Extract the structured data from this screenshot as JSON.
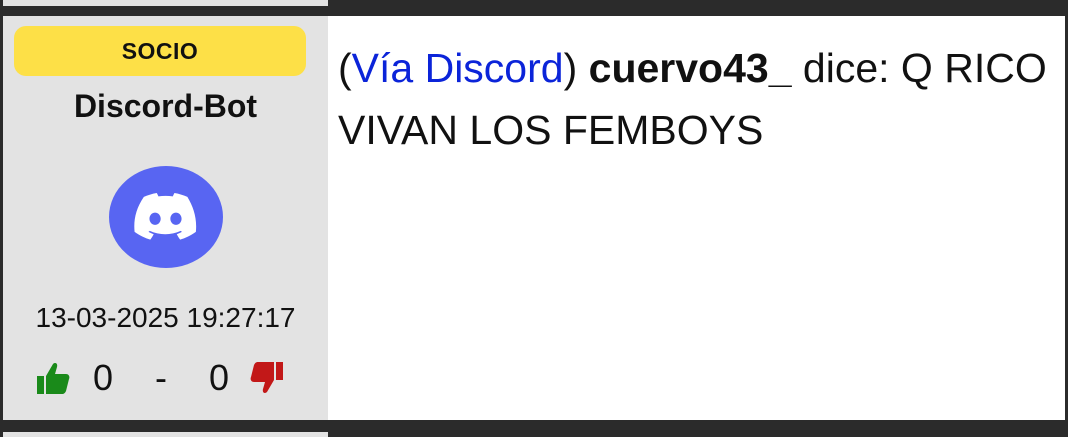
{
  "post": {
    "badge": "SOCIO",
    "username": "Discord-Bot",
    "avatar_icon": "discord-logo-icon",
    "timestamp": "13-03-2025 19:27:17",
    "votes": {
      "up_count": "0",
      "separator": "-",
      "down_count": "0",
      "up_icon": "thumbs-up-icon",
      "down_icon": "thumbs-down-icon",
      "up_color": "#1a8a1a",
      "down_color": "#c21818"
    },
    "message": {
      "open_paren": "(",
      "via_link": "Vía Discord",
      "close_paren": ")",
      "author": "cuervo43_",
      "verb": "dice:",
      "text": "Q RICO VIVAN LOS FEMBOYS"
    }
  },
  "colors": {
    "badge_bg": "#fde047",
    "sidebar_bg": "#e3e3e3",
    "link": "#0b24d9",
    "discord_blurple": "#5865f2",
    "frame": "#2b2b2b"
  }
}
